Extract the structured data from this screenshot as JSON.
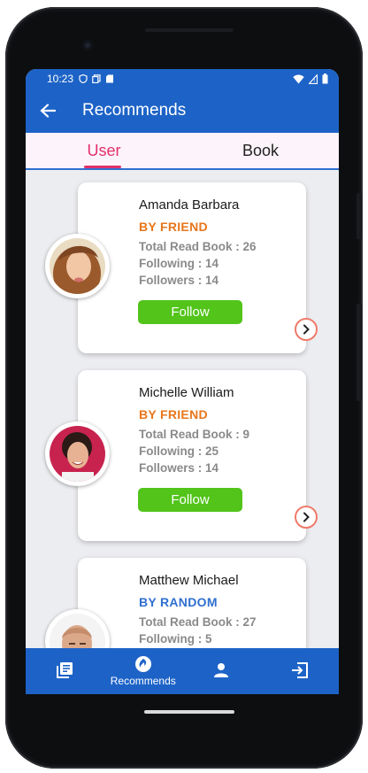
{
  "status_bar": {
    "time": "10:23"
  },
  "app_bar": {
    "title": "Recommends",
    "back_icon": "arrow-left-icon"
  },
  "tabs": [
    {
      "label": "User",
      "active": true
    },
    {
      "label": "Book",
      "active": false
    }
  ],
  "users": [
    {
      "name": "Amanda Barbara",
      "source": "BY FRIEND",
      "source_color": "#e8761b",
      "total_read_book": "Total Read Book : 26",
      "following": "Following : 14",
      "followers": "Followers : 14",
      "follow_label": "Follow"
    },
    {
      "name": "Michelle William",
      "source": "BY FRIEND",
      "source_color": "#e8761b",
      "total_read_book": "Total Read Book : 9",
      "following": "Following : 25",
      "followers": "Followers : 14",
      "follow_label": "Follow"
    },
    {
      "name": "Matthew Michael",
      "source": "BY RANDOM",
      "source_color": "#2f6fcf",
      "total_read_book": "Total Read Book : 27",
      "following": "Following : 5",
      "followers": "",
      "follow_label": ""
    }
  ],
  "bottom_nav": [
    {
      "icon": "library-icon",
      "label": ""
    },
    {
      "icon": "recommends-icon",
      "label": "Recommends"
    },
    {
      "icon": "profile-icon",
      "label": ""
    },
    {
      "icon": "logout-icon",
      "label": ""
    }
  ],
  "colors": {
    "primary": "#1d63c7",
    "accent": "#e0306a",
    "follow_green": "#52c41a"
  }
}
